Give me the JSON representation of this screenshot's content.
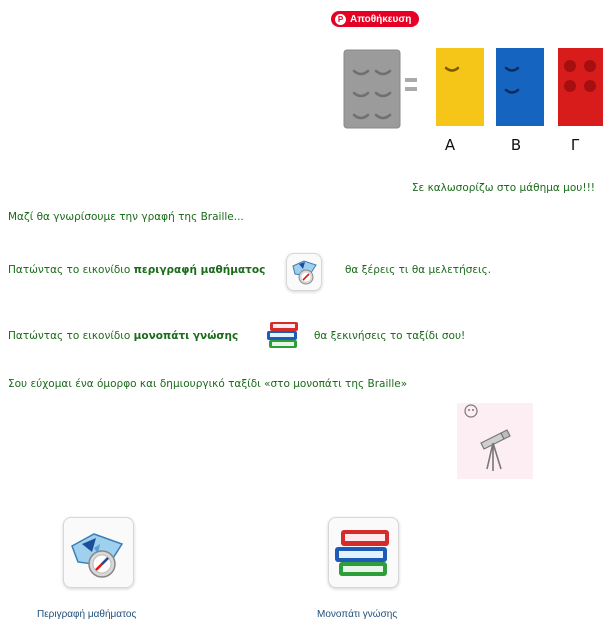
{
  "save_button": {
    "label": "Αποθήκευση",
    "icon": "pinterest-icon",
    "color": "#e60023"
  },
  "braille_image": {
    "equals": "=",
    "labels": [
      "Α",
      "Β",
      "Γ"
    ],
    "colors": {
      "gray": "#9b9b9b",
      "yellow": "#f5c518",
      "blue": "#1565c0",
      "red": "#d81b1b"
    }
  },
  "intro": {
    "welcome": "Σε καλωσορίζω στο μάθημα μου!!!",
    "learn": "Μαζί θα γνωρίσουμε την γραφή της Braille...",
    "line1_before": "Πατώντας το εικονίδιο ",
    "line1_bold": "περιγραφή μαθήματος",
    "line1_after": "θα ξέρεις τι θα μελετήσεις.",
    "line2_before": "Πατώντας το εικονίδιο ",
    "line2_bold": "μονοπάτι γνώσης",
    "line2_after": "θα ξεκινήσεις το ταξίδι σου!",
    "wish": "Σου εύχομαι ένα όμορφο και δημιουργικό ταξίδι «στο μονοπάτι της Braille»"
  },
  "tiles": [
    {
      "label": "Περιγραφή μαθήματος",
      "icon": "compass-map-icon"
    },
    {
      "label": "Μονοπάτι γνώσης",
      "icon": "books-icon"
    }
  ],
  "text_color": "#1a6b1a",
  "link_color": "#1f4e79"
}
